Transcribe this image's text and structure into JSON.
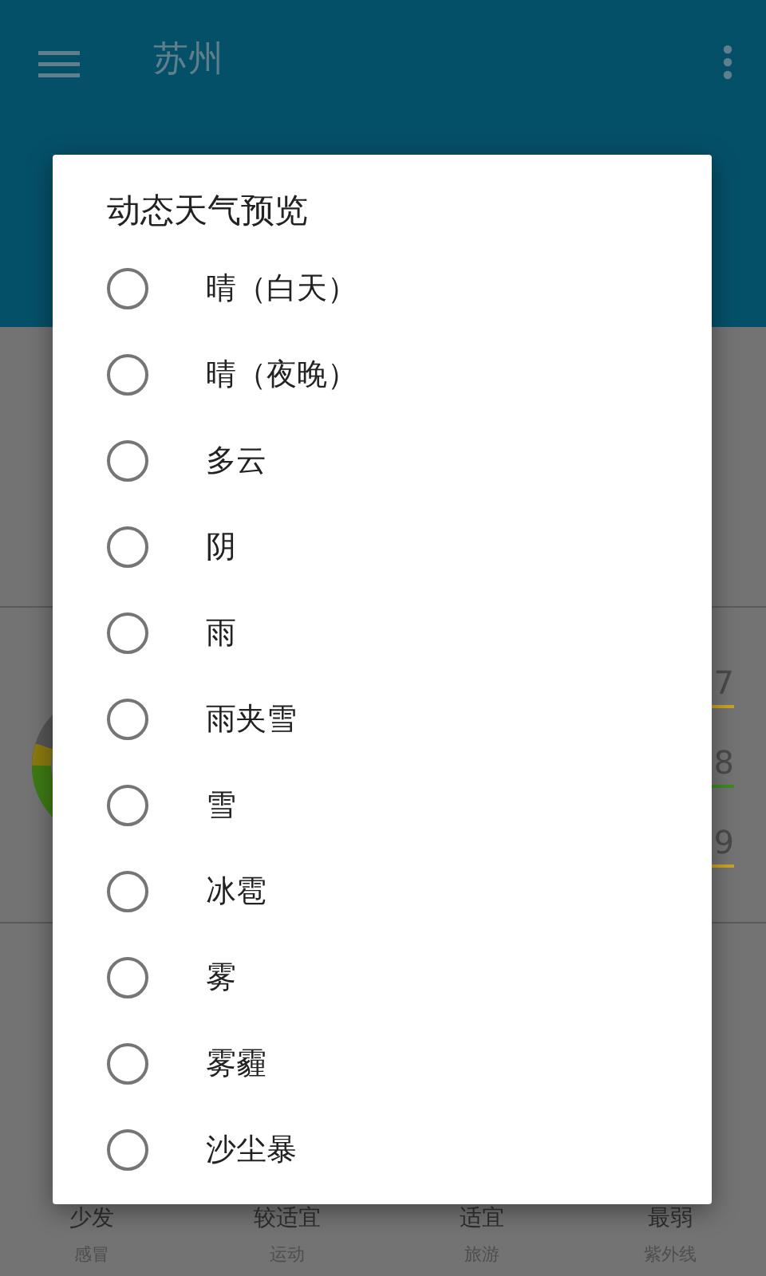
{
  "app_bar": {
    "title": "苏州"
  },
  "readings": [
    {
      "value": "7",
      "color": "#c9a227"
    },
    {
      "value": "8",
      "color": "#3d8c1e"
    },
    {
      "value": "9",
      "color": "#c9a227"
    }
  ],
  "indices": [
    {
      "value": "少发",
      "label": "感冒"
    },
    {
      "value": "较适宜",
      "label": "运动"
    },
    {
      "value": "适宜",
      "label": "旅游"
    },
    {
      "value": "最弱",
      "label": "紫外线"
    }
  ],
  "dialog": {
    "title": "动态天气预览",
    "options": [
      {
        "label": "晴（白天）",
        "selected": false
      },
      {
        "label": "晴（夜晚）",
        "selected": false
      },
      {
        "label": "多云",
        "selected": false
      },
      {
        "label": "阴",
        "selected": false
      },
      {
        "label": "雨",
        "selected": false
      },
      {
        "label": "雨夹雪",
        "selected": false
      },
      {
        "label": "雪",
        "selected": false
      },
      {
        "label": "冰雹",
        "selected": false
      },
      {
        "label": "雾",
        "selected": false
      },
      {
        "label": "雾霾",
        "selected": false
      },
      {
        "label": "沙尘暴",
        "selected": false
      }
    ]
  }
}
